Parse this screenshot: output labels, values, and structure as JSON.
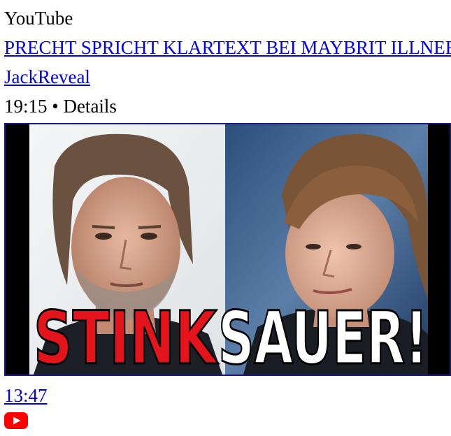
{
  "source_label": "YouTube",
  "video": {
    "title": "PRECHT SPRICHT KLARTEXT BEI MAYBRIT ILLNER",
    "channel": "JackReveal",
    "meta": "19:15 • Details",
    "duration": "13:47",
    "thumbnail_text": {
      "left_word": "STINK",
      "right_word": "SAUER!"
    }
  },
  "colors": {
    "link": "#0000ee",
    "youtube_red": "#ff0000",
    "thumb_text_red": "#e3141b"
  },
  "icons": {
    "play_badge": "youtube-play-icon"
  }
}
